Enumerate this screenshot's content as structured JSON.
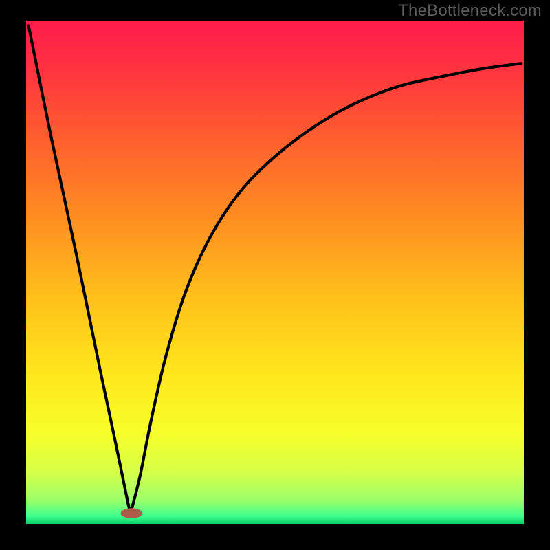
{
  "watermark": "TheBottleneck.com",
  "chart_data": {
    "type": "line",
    "title": "",
    "xlabel": "",
    "ylabel": "",
    "xlim": [
      0,
      100
    ],
    "ylim": [
      0,
      100
    ],
    "gradient_stops": [
      {
        "offset": 0.0,
        "color": "#ff1c4b"
      },
      {
        "offset": 0.08,
        "color": "#ff2e42"
      },
      {
        "offset": 0.22,
        "color": "#ff5a30"
      },
      {
        "offset": 0.38,
        "color": "#ff8a22"
      },
      {
        "offset": 0.55,
        "color": "#ffc01a"
      },
      {
        "offset": 0.7,
        "color": "#ffe61c"
      },
      {
        "offset": 0.82,
        "color": "#f7ff2a"
      },
      {
        "offset": 0.9,
        "color": "#d4ff4a"
      },
      {
        "offset": 0.955,
        "color": "#98ff6b"
      },
      {
        "offset": 0.985,
        "color": "#3cff8e"
      },
      {
        "offset": 1.0,
        "color": "#0cd06b"
      }
    ],
    "series": [
      {
        "name": "curve",
        "comment": "y-values are 'height above bottom' as a percentage of plot height; x is percentage across plot width. Curve: steep drop from top-left to a minimum near x≈21, then a concave rise toward upper-right.",
        "x": [
          0.5,
          5,
          10,
          15,
          18,
          20.5,
          21,
          21.5,
          23,
          25,
          28,
          32,
          37,
          43,
          50,
          58,
          66,
          75,
          84,
          92,
          99.5
        ],
        "y": [
          99,
          77,
          54,
          30,
          16,
          4,
          2.5,
          4,
          10,
          20,
          33,
          46,
          57,
          66,
          73,
          79,
          83.5,
          87,
          89,
          90.5,
          91.5
        ]
      }
    ],
    "marker": {
      "comment": "small brownish-red lozenge at curve minimum",
      "x": 21.2,
      "y": 2.1,
      "rx": 2.2,
      "ry": 1.0,
      "color": "#b05a4a"
    }
  }
}
